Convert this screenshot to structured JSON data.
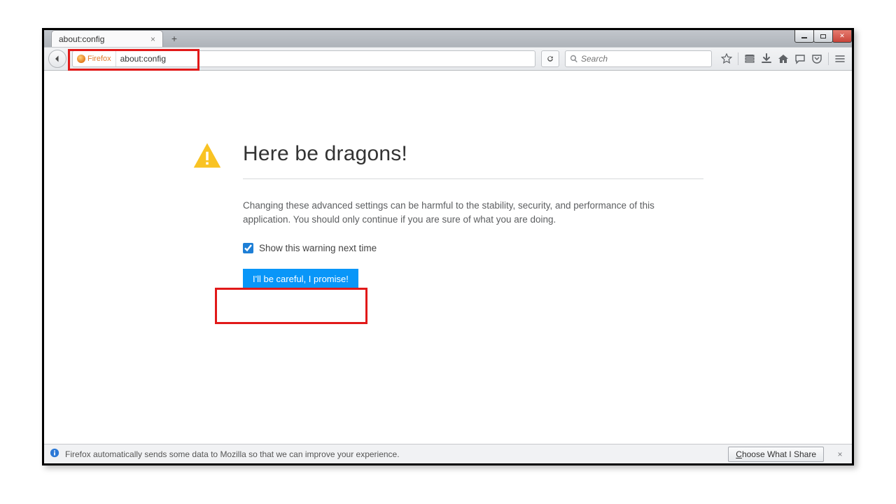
{
  "window": {
    "controls": {
      "min": "minimize",
      "max": "maximize",
      "close": "close"
    }
  },
  "tab": {
    "title": "about:config"
  },
  "nav": {
    "identity_label": "Firefox",
    "url": "about:config"
  },
  "search": {
    "placeholder": "Search"
  },
  "toolbar_icons": [
    "bookmark-star-icon",
    "library-icon",
    "downloads-icon",
    "home-icon",
    "chat-icon",
    "pocket-icon",
    "menu-icon"
  ],
  "warning": {
    "heading": "Here be dragons!",
    "description": "Changing these advanced settings can be harmful to the stability, security, and performance of this application. You should only continue if you are sure of what you are doing.",
    "checkbox_label": "Show this warning next time",
    "checkbox_checked": true,
    "button_label": "I'll be careful, I promise!"
  },
  "footer": {
    "message": "Firefox automatically sends some data to Mozilla so that we can improve your experience.",
    "button_label_pre": "C",
    "button_label_rest": "hoose What I Share"
  }
}
